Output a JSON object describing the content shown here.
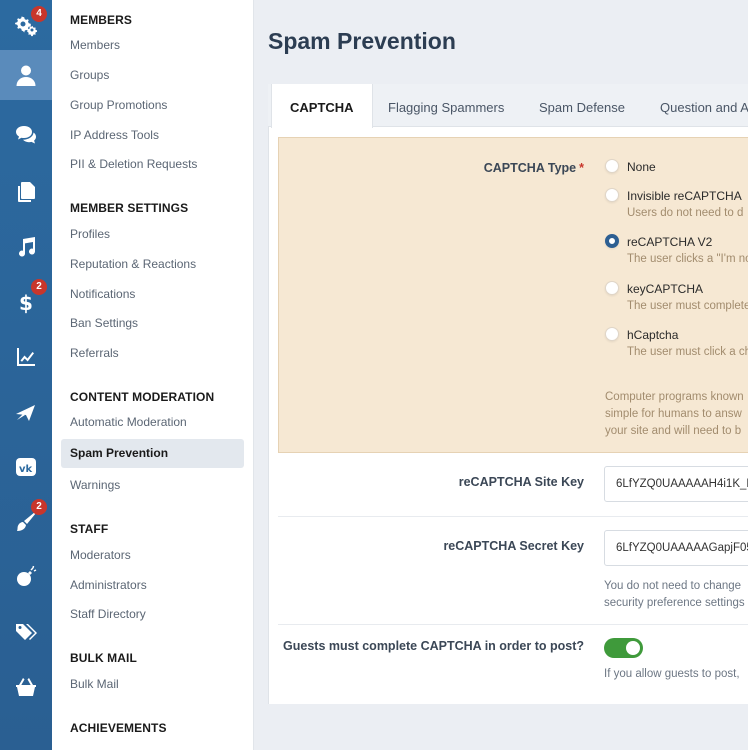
{
  "rail": {
    "items": [
      {
        "icon": "gears-icon",
        "badge": "4"
      },
      {
        "icon": "user-icon",
        "badge": ""
      },
      {
        "icon": "comments-icon",
        "badge": ""
      },
      {
        "icon": "copy-icon",
        "badge": ""
      },
      {
        "icon": "music-icon",
        "badge": ""
      },
      {
        "icon": "dollar-icon",
        "badge": "2"
      },
      {
        "icon": "chart-line-icon",
        "badge": ""
      },
      {
        "icon": "plane-icon",
        "badge": ""
      },
      {
        "icon": "vk-icon",
        "badge": ""
      },
      {
        "icon": "brush-icon",
        "badge": "2"
      },
      {
        "icon": "bomb-icon",
        "badge": ""
      },
      {
        "icon": "tags-icon",
        "badge": ""
      },
      {
        "icon": "basket-icon",
        "badge": ""
      }
    ]
  },
  "subnav": {
    "members": {
      "heading": "MEMBERS",
      "links": [
        "Members",
        "Groups",
        "Group Promotions",
        "IP Address Tools",
        "PII & Deletion Requests"
      ]
    },
    "member_settings": {
      "heading": "MEMBER SETTINGS",
      "links": [
        "Profiles",
        "Reputation & Reactions",
        "Notifications",
        "Ban Settings",
        "Referrals"
      ]
    },
    "content_moderation": {
      "heading": "CONTENT MODERATION",
      "links": [
        "Automatic Moderation",
        "Spam Prevention",
        "Warnings"
      ]
    },
    "staff": {
      "heading": "STAFF",
      "links": [
        "Moderators",
        "Administrators",
        "Staff Directory"
      ]
    },
    "bulk_mail": {
      "heading": "BULK MAIL",
      "links": [
        "Bulk Mail"
      ]
    },
    "achievements": {
      "heading": "ACHIEVEMENTS"
    }
  },
  "page": {
    "title": "Spam Prevention",
    "tabs": [
      "CAPTCHA",
      "Flagging Spammers",
      "Spam Defense",
      "Question and A"
    ]
  },
  "form": {
    "captcha_type": {
      "label": "CAPTCHA Type",
      "required": "*",
      "options": [
        {
          "label": "None",
          "desc": ""
        },
        {
          "label": "Invisible reCAPTCHA",
          "desc": "Users do not need to d"
        },
        {
          "label": "reCAPTCHA V2",
          "desc": "The user clicks a \"I'm no"
        },
        {
          "label": "keyCAPTCHA",
          "desc": "The user must complete"
        },
        {
          "label": "hCaptcha",
          "desc": "The user must click a ch"
        }
      ],
      "selected": "reCAPTCHA V2",
      "explanation": [
        "Computer programs known",
        "simple for humans to answ",
        "your site and will need to b"
      ]
    },
    "site_key": {
      "label": "reCAPTCHA Site Key",
      "value": "6LfYZQ0UAAAAAH4i1K_F"
    },
    "secret_key": {
      "label": "reCAPTCHA Secret Key",
      "value": "6LfYZQ0UAAAAAGapjF05",
      "hint": [
        "You do not need to change",
        "security preference settings"
      ]
    },
    "guests": {
      "label": "Guests must complete CAPTCHA in order to post?",
      "enabled": true,
      "hint": "If you allow guests to post,"
    }
  },
  "colors": {
    "rail": "#2c6aa0",
    "badge": "#c8362b",
    "toggle_on": "#3f9a3b",
    "captcha_panel": "#f6e8d3"
  }
}
